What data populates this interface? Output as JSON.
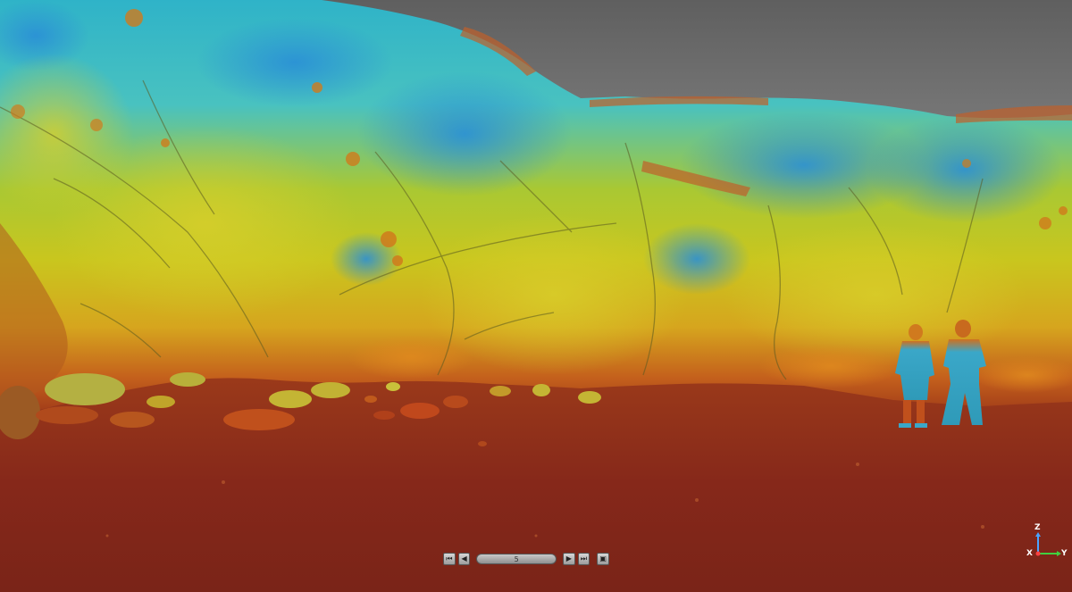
{
  "viewer": {
    "scene": "point-cloud-elevation-view",
    "colors": {
      "sky": "#7a7a7a",
      "ground": "#8b2a1a",
      "low": "#c44a1c",
      "mid": "#c9c61e",
      "high": "#2fb3c8",
      "peak": "#2a8fd6"
    }
  },
  "playback": {
    "first_icon": "skip-to-start-icon",
    "prev_icon": "step-back-icon",
    "frame_value": "5",
    "next_icon": "step-forward-icon",
    "last_icon": "skip-to-end-icon",
    "screen_icon": "fullscreen-icon"
  },
  "axes": {
    "z_label": "Z",
    "x_label": "X",
    "y_label": "Y",
    "z_color": "#4aa3ff",
    "x_color": "#ff4040",
    "y_color": "#40d040"
  }
}
